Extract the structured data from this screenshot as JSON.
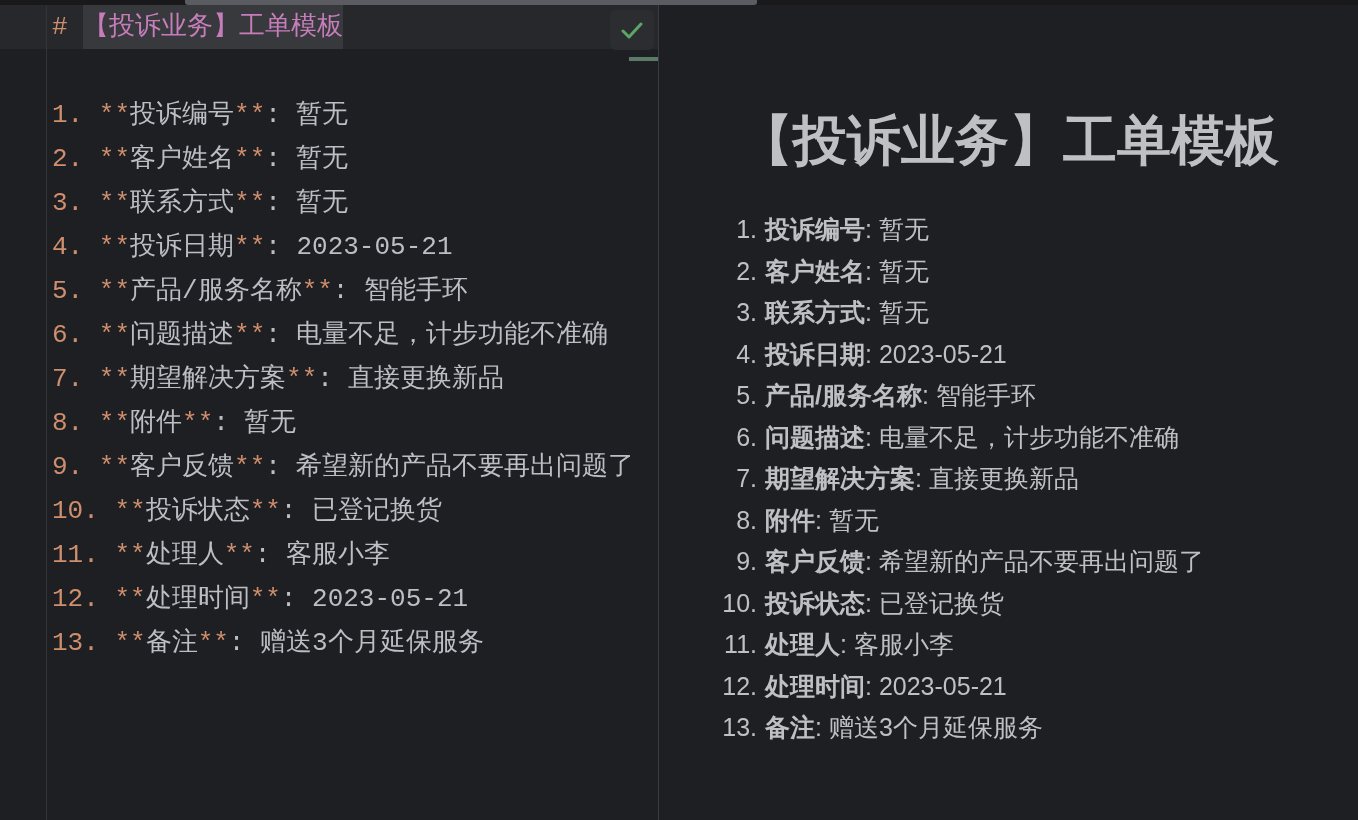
{
  "editor": {
    "heading_line": {
      "current": true,
      "marker": "# ",
      "text": "【投诉业务】工单模板",
      "text_selected": true
    },
    "lines": [
      {
        "marker": "1. ",
        "open": "**",
        "label": "投诉编号",
        "close": "**",
        "rest": ": 暂无"
      },
      {
        "marker": "2. ",
        "open": "**",
        "label": "客户姓名",
        "close": "**",
        "rest": ": 暂无"
      },
      {
        "marker": "3. ",
        "open": "**",
        "label": "联系方式",
        "close": "**",
        "rest": ": 暂无"
      },
      {
        "marker": "4. ",
        "open": "**",
        "label": "投诉日期",
        "close": "**",
        "rest": ": 2023-05-21"
      },
      {
        "marker": "5. ",
        "open": "**",
        "label": "产品/服务名称",
        "close": "**",
        "rest": ": 智能手环"
      },
      {
        "marker": "6. ",
        "open": "**",
        "label": "问题描述",
        "close": "**",
        "rest": ": 电量不足，计步功能不准确"
      },
      {
        "marker": "7. ",
        "open": "**",
        "label": "期望解决方案",
        "close": "**",
        "rest": ": 直接更换新品"
      },
      {
        "marker": "8. ",
        "open": "**",
        "label": "附件",
        "close": "**",
        "rest": ": 暂无"
      },
      {
        "marker": "9. ",
        "open": "**",
        "label": "客户反馈",
        "close": "**",
        "rest": ": 希望新的产品不要再出问题了"
      },
      {
        "marker": "10. ",
        "open": "**",
        "label": "投诉状态",
        "close": "**",
        "rest": ": 已登记换货"
      },
      {
        "marker": "11. ",
        "open": "**",
        "label": "处理人",
        "close": "**",
        "rest": ": 客服小李"
      },
      {
        "marker": "12. ",
        "open": "**",
        "label": "处理时间",
        "close": "**",
        "rest": ": 2023-05-21"
      },
      {
        "marker": "13. ",
        "open": "**",
        "label": "备注",
        "close": "**",
        "rest": ": 赠送3个月延保服务"
      }
    ]
  },
  "preview": {
    "title": "【投诉业务】工单模板",
    "items": [
      {
        "number": "1.",
        "text": "**投诉编号**: 暂无"
      },
      {
        "number": "2.",
        "text": "**客户姓名**: 暂无"
      },
      {
        "number": "3.",
        "text": "**联系方式**: 暂无"
      },
      {
        "number": "4.",
        "text": "**投诉日期**: 2023-05-21"
      },
      {
        "number": "5.",
        "text": "**产品/服务名称**: 智能手环"
      },
      {
        "number": "6.",
        "text": "**问题描述**: 电量不足，计步功能不准确"
      },
      {
        "number": "7.",
        "text": "**期望解决方案**: 直接更换新品"
      },
      {
        "number": "8.",
        "text": "**附件**: 暂无"
      },
      {
        "number": "9.",
        "text": "**客户反馈**: 希望新的产品不要再出问题了"
      },
      {
        "number": "10.",
        "text": "**投诉状态**: 已登记换货"
      },
      {
        "number": "11.",
        "text": "**处理人**: 客服小李"
      },
      {
        "number": "12.",
        "text": "**处理时间**: 2023-05-21"
      },
      {
        "number": "13.",
        "text": "**备注**: 赠送3个月延保服务"
      }
    ]
  }
}
